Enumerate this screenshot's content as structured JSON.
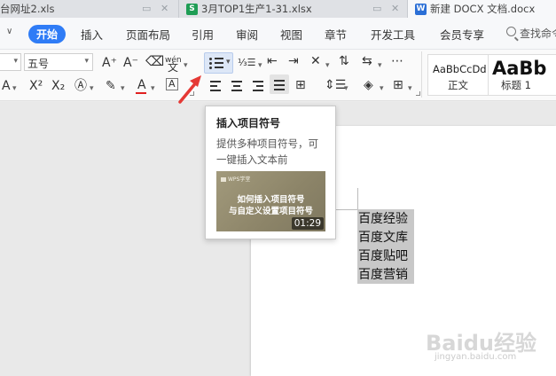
{
  "tabs": [
    {
      "label": "台网址2.xls",
      "badge": "",
      "badge_color": "#1f9d55"
    },
    {
      "label": "3月TOP1生产1-31.xlsx",
      "badge": "S",
      "badge_color": "#1f9d55"
    },
    {
      "label": "新建 DOCX 文档.docx",
      "badge": "W",
      "badge_color": "#2b6fd6"
    }
  ],
  "menu": {
    "active": "开始",
    "items": [
      "插入",
      "页面布局",
      "引用",
      "审阅",
      "视图",
      "章节",
      "开发工具",
      "会员专享"
    ],
    "search_label": "查找命令"
  },
  "toolbar": {
    "font_size": "五号",
    "grow_font": "A⁺",
    "shrink_font": "A⁻",
    "phonetic": "wén",
    "superscript": "X²",
    "subscript": "X₂",
    "font_color_letter": "A",
    "char_shading_letter": "A"
  },
  "styles": [
    {
      "preview": "AaBbCcDd",
      "name": "正文"
    },
    {
      "preview": "AaBb",
      "name": "标题 1"
    }
  ],
  "tooltip": {
    "title": "插入项目符号",
    "desc_line1": "提供多种项目符号，可",
    "desc_line2": "一键插入文本前",
    "video_brand": "WPS学堂",
    "video_line1": "如何插入项目符号",
    "video_line2": "与自定义设置项目符号",
    "video_duration": "01:29"
  },
  "document": {
    "lines": [
      "百度经验",
      "百度文库",
      "百度贴吧",
      "百度营销"
    ]
  },
  "watermark": {
    "main": "Baidu经验",
    "sub": "jingyan.baidu.com"
  },
  "colors": {
    "accent": "#2f7cf6",
    "arrow": "#e53935",
    "selection": "#c8c8c8",
    "font_color_bar": "#e02020"
  }
}
